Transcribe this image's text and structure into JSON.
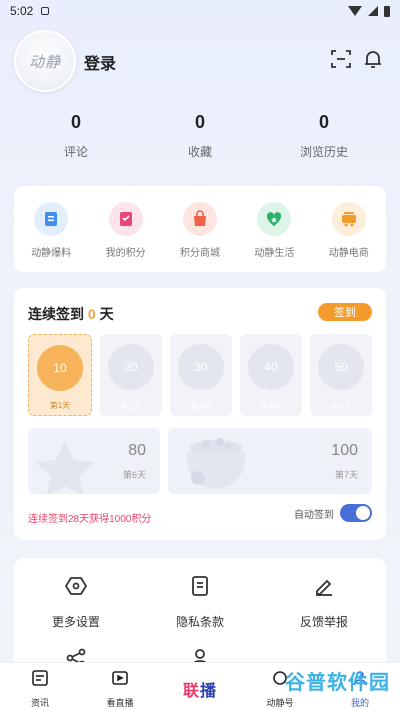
{
  "status_bar": {
    "time": "5:02"
  },
  "header": {
    "avatar_text": "动静",
    "login_label": "登录"
  },
  "stats": [
    {
      "value": "0",
      "label": "评论"
    },
    {
      "value": "0",
      "label": "收藏"
    },
    {
      "value": "0",
      "label": "浏览历史"
    }
  ],
  "features": [
    {
      "label": "动静爆料",
      "icon": "note-icon",
      "color": "#3f8ef0"
    },
    {
      "label": "我的积分",
      "icon": "points-icon",
      "color": "#e8457c"
    },
    {
      "label": "积分商城",
      "icon": "shopping-bag-icon",
      "color": "#f0624a"
    },
    {
      "label": "动静生活",
      "icon": "heart-star-icon",
      "color": "#2fb069"
    },
    {
      "label": "动静电商",
      "icon": "cart-icon",
      "color": "#f39a2b"
    }
  ],
  "checkin": {
    "title_prefix": "连续签到 ",
    "days": "0",
    "title_suffix": " 天",
    "button_label": "签到",
    "day_items": [
      {
        "points": "10",
        "label": "第1天"
      },
      {
        "points": "20",
        "label": "第2天"
      },
      {
        "points": "30",
        "label": "第3天"
      },
      {
        "points": "40",
        "label": "第4天"
      },
      {
        "points": "50",
        "label": "第5天"
      }
    ],
    "day6": {
      "points": "80",
      "label": "第6天"
    },
    "day7": {
      "points": "100",
      "label": "第7天"
    },
    "note": "连续签到28天获得1000积分",
    "auto_label": "自动签到"
  },
  "settings": {
    "items": [
      {
        "label": "更多设置",
        "icon": "settings-hex-icon"
      },
      {
        "label": "隐私条款",
        "icon": "document-icon"
      },
      {
        "label": "反馈举报",
        "icon": "pen-icon"
      }
    ]
  },
  "tabbar": {
    "tabs": [
      {
        "label": "资讯"
      },
      {
        "label": "看直播"
      },
      {
        "label": "联播",
        "logo_a": "联",
        "logo_b": "播"
      },
      {
        "label": "动静号"
      },
      {
        "label": "我的"
      }
    ]
  },
  "watermark": "谷普软件园"
}
